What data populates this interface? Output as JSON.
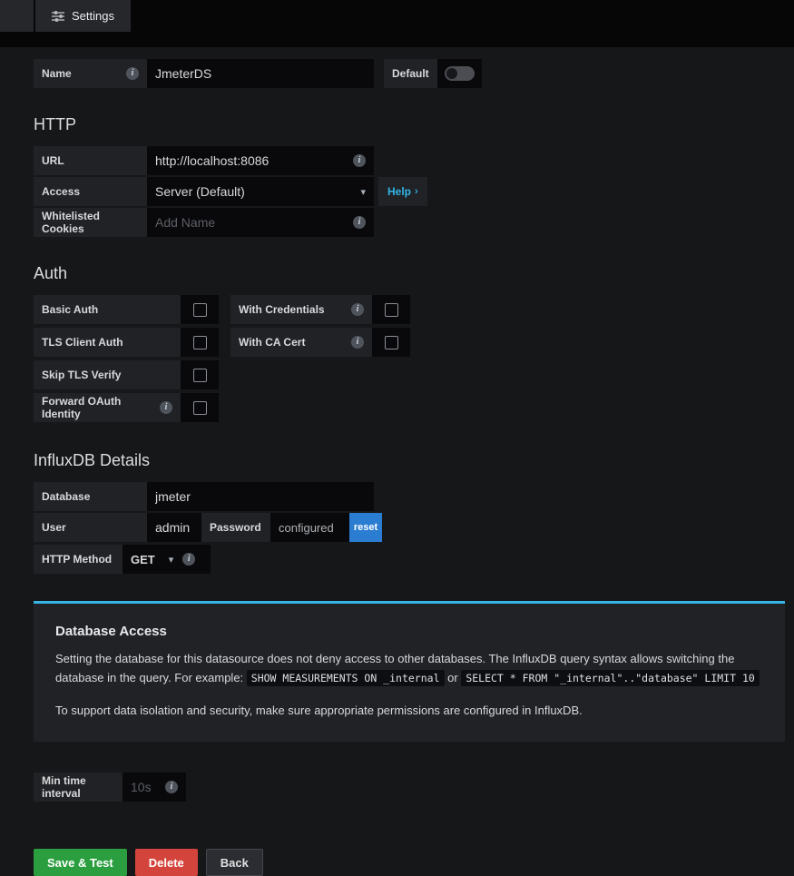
{
  "colors": {
    "accent": "#33b5e5",
    "success": "#2b9e3f",
    "danger": "#d3453c",
    "primary": "#2a7dd0"
  },
  "icons": {
    "info": "i",
    "caret_down": "▾",
    "chevron_right": "›"
  },
  "tabbar": {
    "settings": "Settings"
  },
  "general": {
    "name_label": "Name",
    "name_value": "JmeterDS",
    "default_label": "Default"
  },
  "http": {
    "heading": "HTTP",
    "url_label": "URL",
    "url_value": "http://localhost:8086",
    "access_label": "Access",
    "access_value": "Server (Default)",
    "help_label": "Help",
    "cookies_label": "Whitelisted Cookies",
    "cookies_placeholder": "Add Name"
  },
  "auth": {
    "heading": "Auth",
    "basic_auth": "Basic Auth",
    "with_credentials": "With Credentials",
    "tls_client_auth": "TLS Client Auth",
    "with_ca_cert": "With CA Cert",
    "skip_tls_verify": "Skip TLS Verify",
    "forward_oauth": "Forward OAuth Identity"
  },
  "influx": {
    "heading": "InfluxDB Details",
    "database_label": "Database",
    "database_value": "jmeter",
    "user_label": "User",
    "user_value": "admin",
    "password_label": "Password",
    "password_status": "configured",
    "reset_label": "reset",
    "method_label": "HTTP Method",
    "method_value": "GET"
  },
  "infobox": {
    "title": "Database Access",
    "p1": "Setting the database for this datasource does not deny access to other databases. The InfluxDB query syntax allows switching the database in the query. For example:",
    "code1": "SHOW MEASUREMENTS ON _internal",
    "or": "or",
    "code2": "SELECT * FROM \"_internal\"..\"database\" LIMIT 10",
    "p2": "To support data isolation and security, make sure appropriate permissions are configured in InfluxDB."
  },
  "interval": {
    "label": "Min time interval",
    "placeholder": "10s"
  },
  "actions": {
    "save": "Save & Test",
    "delete": "Delete",
    "back": "Back"
  }
}
